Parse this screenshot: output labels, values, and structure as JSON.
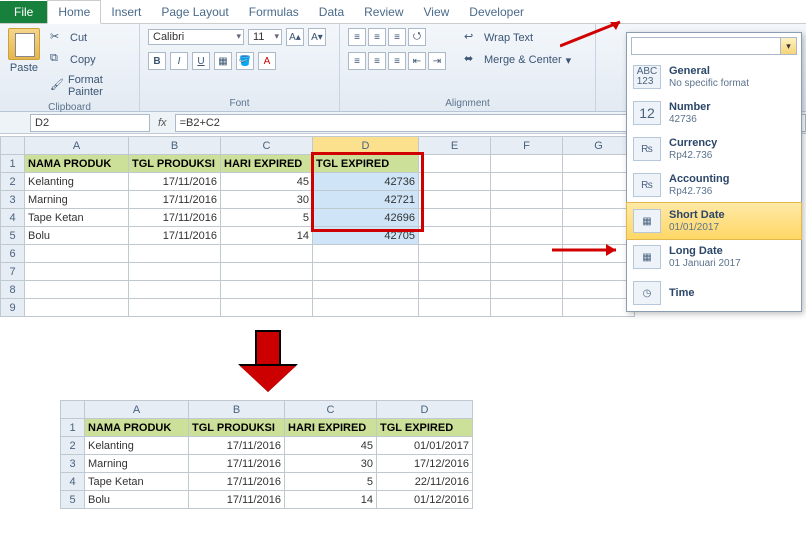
{
  "tabs": {
    "file": "File",
    "home": "Home",
    "insert": "Insert",
    "page_layout": "Page Layout",
    "formulas": "Formulas",
    "data": "Data",
    "review": "Review",
    "view": "View",
    "developer": "Developer"
  },
  "clipboard": {
    "paste": "Paste",
    "cut": "Cut",
    "copy": "Copy",
    "format_painter": "Format Painter",
    "label": "Clipboard"
  },
  "font": {
    "name": "Calibri",
    "size": "11",
    "label": "Font"
  },
  "alignment": {
    "wrap": "Wrap Text",
    "merge": "Merge & Center",
    "label": "Alignment"
  },
  "namebox": "D2",
  "formula": "=B2+C2",
  "columns": [
    "A",
    "B",
    "C",
    "D",
    "E",
    "F",
    "G"
  ],
  "row_numbers": [
    "1",
    "2",
    "3",
    "4",
    "5",
    "6",
    "7",
    "8",
    "9"
  ],
  "headers": {
    "a": "NAMA PRODUK",
    "b": "TGL PRODUKSI",
    "c": "HARI EXPIRED",
    "d": "TGL EXPIRED"
  },
  "rows": [
    {
      "a": "Kelanting",
      "b": "17/11/2016",
      "c": "45",
      "d": "42736"
    },
    {
      "a": "Marning",
      "b": "17/11/2016",
      "c": "30",
      "d": "42721"
    },
    {
      "a": "Tape Ketan",
      "b": "17/11/2016",
      "c": "5",
      "d": "42696"
    },
    {
      "a": "Bolu",
      "b": "17/11/2016",
      "c": "14",
      "d": "42705"
    }
  ],
  "numfmt": {
    "general": {
      "t": "General",
      "s": "No specific format"
    },
    "number": {
      "t": "Number",
      "s": "42736"
    },
    "currency": {
      "t": "Currency",
      "s": "Rp42.736"
    },
    "accounting": {
      "t": "Accounting",
      "s": "Rp42.736"
    },
    "shortdate": {
      "t": "Short Date",
      "s": "01/01/2017"
    },
    "longdate": {
      "t": "Long Date",
      "s": "01 Januari 2017"
    },
    "time": {
      "t": "Time",
      "s": ""
    }
  },
  "sheet2": {
    "columns": [
      "A",
      "B",
      "C",
      "D"
    ],
    "row_numbers": [
      "1",
      "2",
      "3",
      "4",
      "5"
    ],
    "rows": [
      {
        "a": "Kelanting",
        "b": "17/11/2016",
        "c": "45",
        "d": "01/01/2017"
      },
      {
        "a": "Marning",
        "b": "17/11/2016",
        "c": "30",
        "d": "17/12/2016"
      },
      {
        "a": "Tape Ketan",
        "b": "17/11/2016",
        "c": "5",
        "d": "22/11/2016"
      },
      {
        "a": "Bolu",
        "b": "17/11/2016",
        "c": "14",
        "d": "01/12/2016"
      }
    ]
  },
  "icons": {
    "abc123": "ABC\n123",
    "num12": "12",
    "cur": "₨",
    "acc": "₨",
    "date": "▦",
    "clock": "◷"
  }
}
